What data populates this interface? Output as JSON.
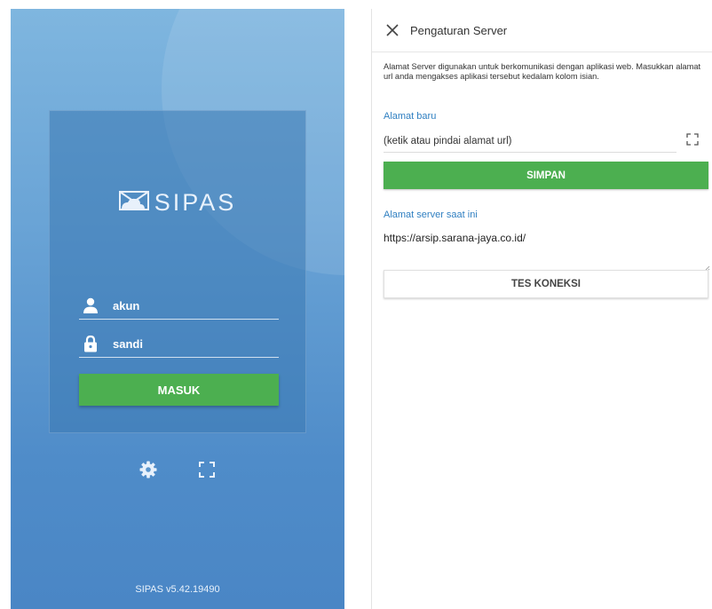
{
  "login": {
    "brand": "SIPAS",
    "username_placeholder": "akun",
    "password_placeholder": "sandi",
    "submit_label": "MASUK",
    "version": "SIPAS v5.42.19490",
    "icons": {
      "user": "user-icon",
      "lock": "lock-icon",
      "settings": "gear-icon",
      "scan": "scan-icon",
      "logo": "envelope-cloud-logo"
    }
  },
  "settings": {
    "title": "Pengaturan Server",
    "description": "Alamat Server digunakan untuk berkomunikasi dengan aplikasi web. Masukkan alamat url anda mengakses aplikasi tersebut kedalam kolom isian.",
    "new_address_label": "Alamat baru",
    "new_address_placeholder": "(ketik atau pindai alamat url)",
    "save_label": "SIMPAN",
    "current_address_label": "Alamat server saat ini",
    "current_address_value": "https://arsip.sarana-jaya.co.id/",
    "test_label": "TES KONEKSI",
    "icons": {
      "close": "close-icon",
      "scan": "scan-icon"
    }
  },
  "colors": {
    "accent_green": "#4caf50",
    "label_blue": "#2f7fc1",
    "login_bg_top": "#7fb6df",
    "login_bg_bottom": "#4a86c5"
  }
}
